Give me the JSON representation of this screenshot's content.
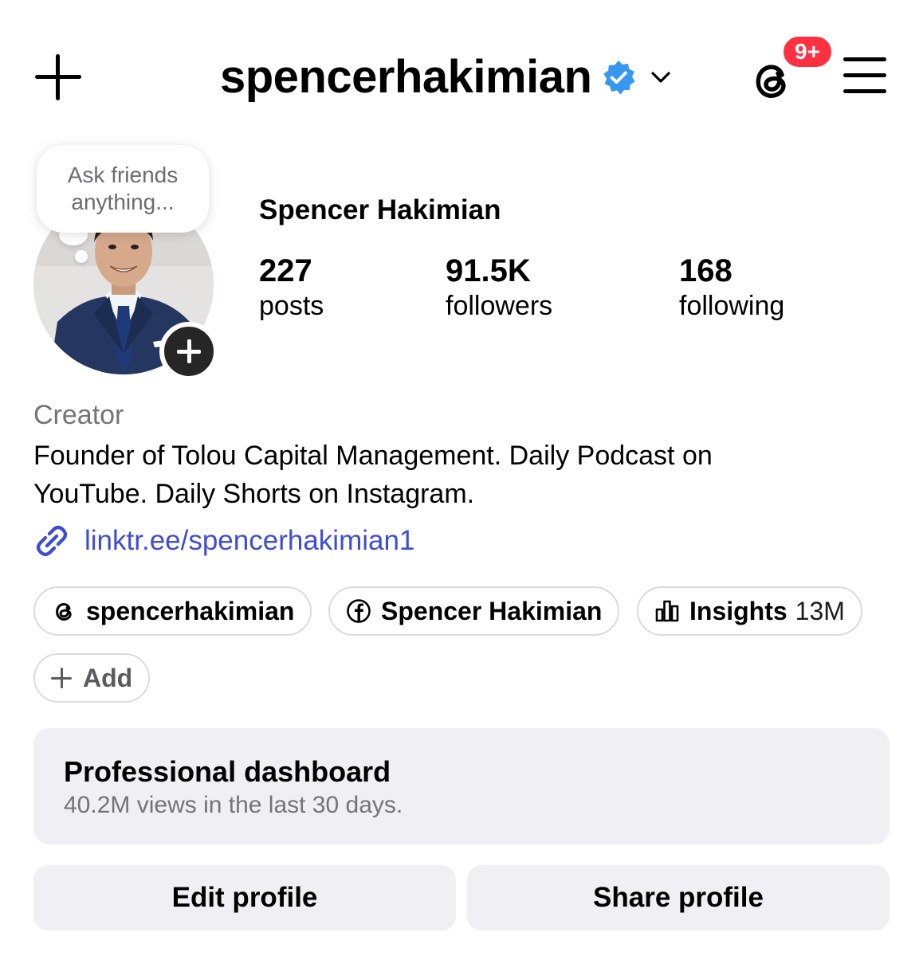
{
  "header": {
    "username": "spencerhakimian",
    "notification_badge": "9+",
    "badge_color": "#ff3040",
    "icons": [
      "plus-icon",
      "verified-badge-icon",
      "chevron-down-icon",
      "threads-icon",
      "menu-icon"
    ]
  },
  "profile": {
    "note_text": "Ask friends anything...",
    "display_name": "Spencer Hakimian",
    "stats": {
      "posts": {
        "value": "227",
        "label": "posts"
      },
      "followers": {
        "value": "91.5K",
        "label": "followers"
      },
      "following": {
        "value": "168",
        "label": "following"
      }
    },
    "category": "Creator",
    "bio": "Founder of Tolou Capital Management. Daily Podcast on YouTube. Daily Shorts on Instagram.",
    "link": "linktr.ee/spencerhakimian1",
    "link_color": "#3f4dd1"
  },
  "pills": {
    "threads": "spencerhakimian",
    "facebook": "Spencer Hakimian",
    "insights_label": "Insights",
    "insights_value": "13M",
    "add": "Add"
  },
  "dashboard": {
    "title": "Professional dashboard",
    "subtitle": "40.2M views in the last 30 days."
  },
  "actions": {
    "edit": "Edit profile",
    "share": "Share profile"
  }
}
